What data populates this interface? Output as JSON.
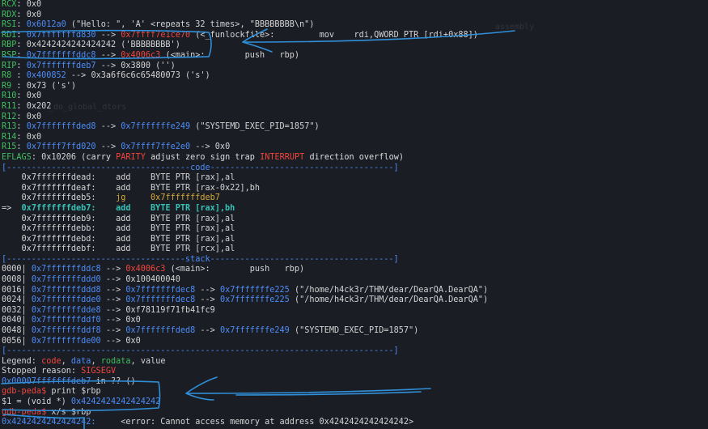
{
  "registers": {
    "rcx": {
      "name": "RCX",
      "value": "0x0"
    },
    "rdx": {
      "name": "RDX",
      "value": "0x0"
    },
    "rsi": {
      "name": "RSI",
      "addr": "0x6012a0",
      "rest": "(\"Hello: \", 'A' <repeats 32 times>, \"BBBBBBBB\\n\")"
    },
    "rdi": {
      "name": "RDI",
      "addr": "0x7fffffffd830",
      "arrow": "-->",
      "target": "0x7ffff7e1ce70",
      "rest": "(<_funlockfile>:         mov    rdi,QWORD PTR [rdi+0x88])"
    },
    "rbp": {
      "name": "RBP",
      "value": "0x4242424242424242 ('BBBBBBBB')"
    },
    "rsp": {
      "name": "RSP",
      "addr": "0x7fffffffddc8",
      "arrow": "-->",
      "target": "0x4006c3",
      "rest": "(<main>:        push   rbp)"
    },
    "rip": {
      "name": "RIP",
      "addr": "0x7fffffffdeb7",
      "rest": "--> 0x3800 ('')"
    },
    "r8": {
      "name": "R8 ",
      "addr": "0x400852",
      "rest": "--> 0x3a6f6c6c65480073 ('s')"
    },
    "r9": {
      "name": "R9 ",
      "value": "0x73 ('s')"
    },
    "r10": {
      "name": "R10",
      "value": "0x0"
    },
    "r11": {
      "name": "R11",
      "value": "0x202"
    },
    "r12": {
      "name": "R12",
      "value": "0x0"
    },
    "r13": {
      "name": "R13",
      "addr": "0x7fffffffded8",
      "mid": "-->",
      "addr2": "0x7fffffffe249",
      "rest": "(\"SYSTEMD_EXEC_PID=1857\")"
    },
    "r14": {
      "name": "R14",
      "value": "0x0"
    },
    "r15": {
      "name": "R15",
      "addr": "0x7ffff7ffd020",
      "mid": "-->",
      "addr2": "0x7ffff7ffe2e0",
      "rest": "--> 0x0"
    }
  },
  "eflags": {
    "label": "EFLAGS",
    "value": "0x10206",
    "flags": [
      {
        "text": "carry",
        "set": false
      },
      {
        "text": "PARITY",
        "set": true
      },
      {
        "text": "adjust",
        "set": false
      },
      {
        "text": "zero",
        "set": false
      },
      {
        "text": "sign",
        "set": false
      },
      {
        "text": "trap",
        "set": false
      },
      {
        "text": "INTERRUPT",
        "set": true
      },
      {
        "text": "direction",
        "set": false
      },
      {
        "text": "overflow",
        "set": false
      }
    ]
  },
  "code": {
    "header": "[-------------------------------------code-------------------------------------]",
    "lines": [
      {
        "addr": "0x7fffffffdead:",
        "op": "add",
        "args": "BYTE PTR [rax],al"
      },
      {
        "addr": "0x7fffffffdeaf:",
        "op": "add",
        "args": "BYTE PTR [rax-0x22],bh"
      },
      {
        "addr": "0x7fffffffdeb5:",
        "op": "jg",
        "args": "0x7fffffffdeb7"
      },
      {
        "addr": "0x7fffffffdeb7:",
        "op": "add",
        "args": "BYTE PTR [rax],bh",
        "current": true,
        "arrow": "=>"
      },
      {
        "addr": "0x7fffffffdeb9:",
        "op": "add",
        "args": "BYTE PTR [rax],al"
      },
      {
        "addr": "0x7fffffffdebb:",
        "op": "add",
        "args": "BYTE PTR [rax],al"
      },
      {
        "addr": "0x7fffffffdebd:",
        "op": "add",
        "args": "BYTE PTR [rax],al"
      },
      {
        "addr": "0x7fffffffdebf:",
        "op": "add",
        "args": "BYTE PTR [rcx],al"
      }
    ]
  },
  "stack": {
    "header": "[------------------------------------stack-------------------------------------]",
    "lines": [
      {
        "off": "0000|",
        "addr": "0x7fffffffddc8",
        "arrow": "-->",
        "target": "0x4006c3",
        "targetColor": "r",
        "rest": "(<main>:        push   rbp)"
      },
      {
        "off": "0008|",
        "addr": "0x7fffffffddd0",
        "rest": "--> 0x100400040"
      },
      {
        "off": "0016|",
        "addr": "0x7fffffffddd8",
        "arrow": "-->",
        "target": "0x7fffffffdec8",
        "mid": "-->",
        "target2": "0x7fffffffe225",
        "rest": "(\"/home/h4ck3r/THM/dear/DearQA.DearQA\")"
      },
      {
        "off": "0024|",
        "addr": "0x7fffffffdde0",
        "arrow": "-->",
        "target": "0x7fffffffdec8",
        "mid": "-->",
        "target2": "0x7fffffffe225",
        "rest": "(\"/home/h4ck3r/THM/dear/DearQA.DearQA\")"
      },
      {
        "off": "0032|",
        "addr": "0x7fffffffdde8",
        "rest": "--> 0xf78119f71fb41fc9"
      },
      {
        "off": "0040|",
        "addr": "0x7fffffffddf0",
        "rest": "--> 0x0"
      },
      {
        "off": "0048|",
        "addr": "0x7fffffffddf8",
        "arrow": "-->",
        "target": "0x7fffffffded8",
        "mid": "-->",
        "target2": "0x7fffffffe249",
        "rest": "(\"SYSTEMD_EXEC_PID=1857\")"
      },
      {
        "off": "0056|",
        "addr": "0x7fffffffde00",
        "rest": "--> 0x0"
      }
    ],
    "footer": "[------------------------------------------------------------------------------]"
  },
  "legend": {
    "label": "Legend:",
    "code": "code",
    "data": "data",
    "rodata": "rodata",
    "value": "value"
  },
  "stopped": {
    "label": "Stopped reason:",
    "reason": "SIGSEGV"
  },
  "frame": {
    "addr": "0x00007fffffffdeb7",
    "rest": "in ?? ()"
  },
  "prompt1": {
    "prompt": "gdb-peda$",
    "cmd": " print $rbp"
  },
  "result1": {
    "text": "$1 = (void *) ",
    "value": "0x4242424242424242"
  },
  "prompt2": {
    "prompt": "gdb-peda$",
    "cmd": " x/s $rbp"
  },
  "result2": {
    "addr": "0x4242424242424242:",
    "text": "     <error: Cannot access memory at address 0x4242424242424242>"
  },
  "ghost": {
    "g1": "assembly",
    "g2": "_do_global_dtors"
  },
  "annotation_color": "#2f8fd8"
}
